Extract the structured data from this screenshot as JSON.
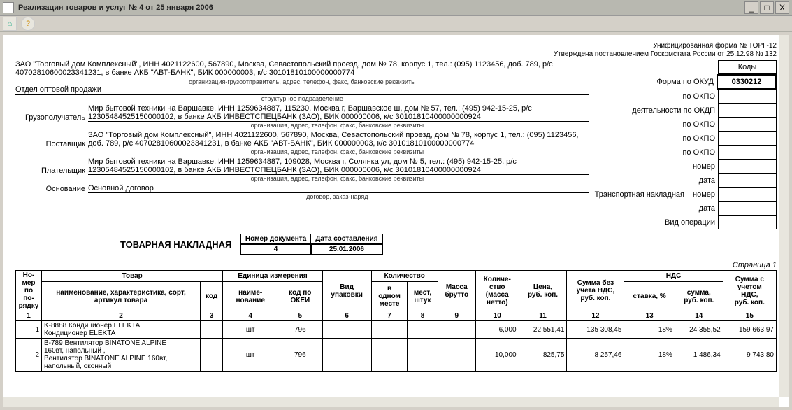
{
  "window_title": "Реализация товаров и услуг № 4 от 25 января 2006",
  "form_info": {
    "form_line": "Унифицированная форма № ТОРГ-12",
    "approved_line": "Утверждена постановлением Госкомстата России от 25.12.98 № 132"
  },
  "codes_header": "Коды",
  "codes_labels": {
    "okud": "Форма по ОКУД",
    "okpo1": "по ОКПО",
    "okdp": "деятельности по ОКДП",
    "okpo2": "по ОКПО",
    "okpo3": "по ОКПО",
    "okpo4": "по ОКПО",
    "number": "номер",
    "date": "дата",
    "trans": "Транспортная накладная",
    "number2": "номер",
    "date2": "дата",
    "vid": "Вид операции"
  },
  "okud_code": "0330212",
  "org": {
    "sender": "ЗАО \"Торговый дом Комплексный\", ИНН 4021122600, 567890, Москва, Севастопольский проезд, дом № 78, корпус 1, тел.: (095) 1123456, доб. 789, р/с 40702810600023341231, в банке АКБ \"АВТ-БАНК\", БИК 000000003, к/с 30101810100000000774",
    "sender_sub": "организация-грузоотправитель, адрес, телефон, факс, банковские реквизиты",
    "department": "Отдел оптовой продажи",
    "department_sub": "структурное подразделение",
    "consignee_label": "Грузополучатель",
    "consignee": "Мир бытовой техники на Варшавке, ИНН 1259634887, 115230, Москва г, Варшавское ш, дом № 57, тел.: (495) 942-15-25, р/с 12305484525150000102, в банке АКБ ИНВЕСТСПЕЦБАНК (ЗАО), БИК 000000006, к/с 30101810400000000924",
    "consignee_sub": "организация, адрес, телефон, факс, банковские реквизиты",
    "supplier_label": "Поставщик",
    "supplier": "ЗАО \"Торговый дом Комплексный\", ИНН 4021122600, 567890, Москва, Севастопольский проезд, дом № 78, корпус 1, тел.: (095) 1123456, доб. 789, р/с 40702810600023341231, в банке АКБ \"АВТ-БАНК\", БИК 000000003, к/с 30101810100000000774",
    "supplier_sub": "организация, адрес, телефон, факс, банковские реквизиты",
    "payer_label": "Плательщик",
    "payer": "Мир бытовой техники на Варшавке, ИНН 1259634887, 109028, Москва г, Солянка ул, дом № 5, тел.: (495) 942-15-25, р/с 12305484525150000102, в банке АКБ ИНВЕСТСПЕЦБАНК (ЗАО), БИК 000000006, к/с 30101810400000000924",
    "payer_sub": "организация, адрес, телефон, факс, банковские реквизиты",
    "basis_label": "Основание",
    "basis": "Основной договор",
    "basis_sub": "договор, заказ-наряд"
  },
  "numbox": {
    "doc_num_h": "Номер документа",
    "doc_date_h": "Дата составления",
    "doc_num": "4",
    "doc_date": "25.01.2006",
    "title": "ТОВАРНАЯ НАКЛАДНАЯ"
  },
  "page_label": "Страница 1",
  "table": {
    "h_num": "Но-\nмер\nпо по-\nрядку",
    "h_tovar": "Товар",
    "h_unit": "Единица измерения",
    "h_pack": "Вид\nупаковки",
    "h_qty": "Количество",
    "h_gross": "Масса\nбрутто",
    "h_netqty": "Количе-\nство\n(масса\nнетто)",
    "h_price": "Цена,\nруб. коп.",
    "h_sum_no_vat": "Сумма без\nучета НДС,\nруб. коп.",
    "h_vat": "НДС",
    "h_sum_vat": "Сумма с\nучетом\nНДС,\nруб. коп.",
    "h_name": "наименование, характеристика, сорт,\nартикул товара",
    "h_code": "код",
    "h_uname": "наиме-\nнование",
    "h_okei": "код по\nОКЕИ",
    "h_inone": "в\nодном\nместе",
    "h_places": "мест,\nштук",
    "h_rate": "ставка, %",
    "h_vatsum": "сумма,\nруб. коп.",
    "cols": [
      "1",
      "2",
      "3",
      "4",
      "5",
      "6",
      "7",
      "8",
      "9",
      "10",
      "11",
      "12",
      "13",
      "14",
      "15"
    ],
    "rows": [
      {
        "n": "1",
        "name": "K-8888  Кондиционер ELEKTA\nКондиционер ELEKTA",
        "code": "",
        "unit": "шт",
        "okei": "796",
        "pack": "",
        "inone": "",
        "places": "",
        "gross": "",
        "net": "6,000",
        "price": "22 551,41",
        "sum_no_vat": "135 308,45",
        "vat_rate": "18%",
        "vat_sum": "24 355,52",
        "sum_vat": "159 663,97"
      },
      {
        "n": "2",
        "name": "B-789  Вентилятор BINATONE ALPINE\n160вт, напольный ,\nВентилятор BINATONE ALPINE 160вт,\nнапольный,  оконный",
        "code": "",
        "unit": "шт",
        "okei": "796",
        "pack": "",
        "inone": "",
        "places": "",
        "gross": "",
        "net": "10,000",
        "price": "825,75",
        "sum_no_vat": "8 257,46",
        "vat_rate": "18%",
        "vat_sum": "1 486,34",
        "sum_vat": "9 743,80"
      }
    ]
  }
}
